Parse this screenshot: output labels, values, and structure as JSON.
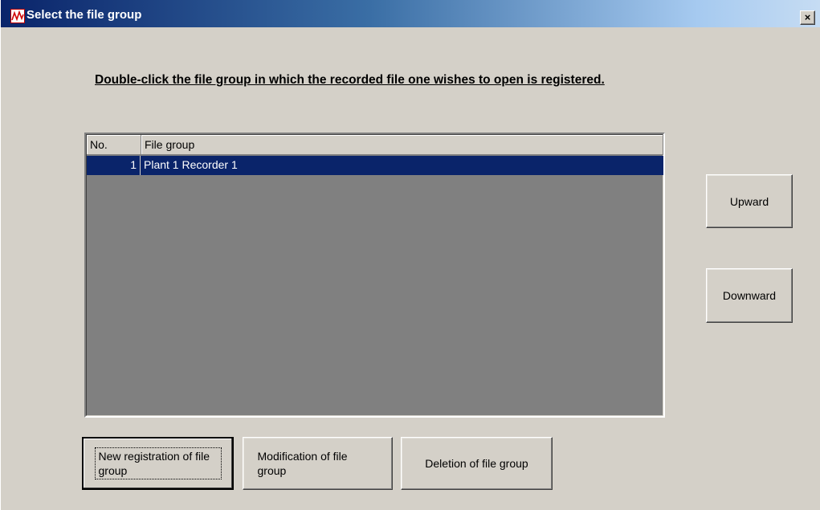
{
  "window": {
    "title": "Select the file group",
    "close_glyph": "×",
    "icon": "chart-trend-icon"
  },
  "instruction": "Double-click the file group in which the recorded file one wishes to open is registered.",
  "list": {
    "columns": [
      "No.",
      "File group"
    ],
    "rows": [
      {
        "no": "1",
        "name": "Plant 1 Recorder 1",
        "selected": true
      }
    ],
    "selected_row_color": "#0a246a",
    "background_color": "#808080"
  },
  "buttons": {
    "upward": "Upward",
    "downward": "Downward",
    "new_registration": "New registration of file group",
    "modification": "Modification of file group",
    "deletion": "Deletion of file group"
  }
}
